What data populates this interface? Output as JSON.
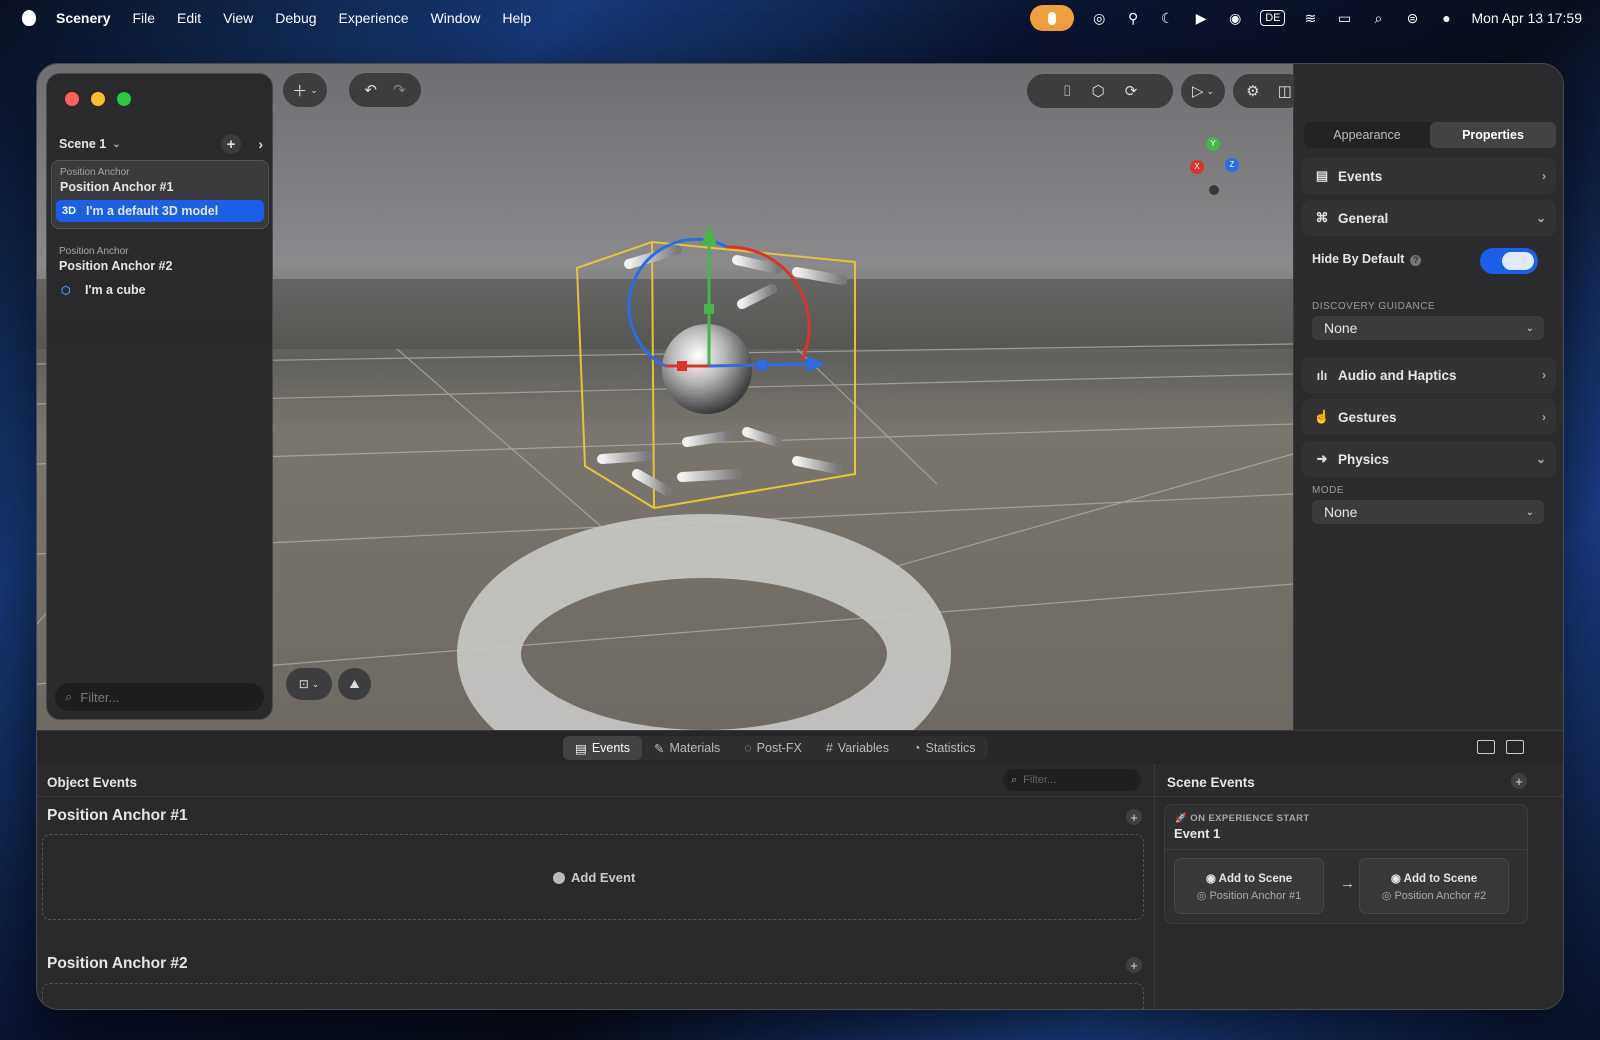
{
  "menubar": {
    "app_name": "Scenery",
    "items": [
      "File",
      "Edit",
      "View",
      "Debug",
      "Experience",
      "Window",
      "Help"
    ],
    "input_source": "DE",
    "clock": "Mon Apr 13  17:59"
  },
  "sidebar": {
    "scene_name": "Scene 1",
    "anchors": [
      {
        "kind": "Position Anchor",
        "name": "Position Anchor #1",
        "child_badge": "3D",
        "child_label": "I'm a default 3D model"
      },
      {
        "kind": "Position Anchor",
        "name": "Position Anchor #2",
        "child_badge": "",
        "child_label": "I'm a cube"
      }
    ],
    "filter_placeholder": "Filter..."
  },
  "gizmo": {
    "y": "Y",
    "x": "X",
    "z": "Z"
  },
  "inspector": {
    "tabs": [
      "Appearance",
      "Properties"
    ],
    "active_tab": "Properties",
    "sections": {
      "events": "Events",
      "general": "General",
      "audio": "Audio and Haptics",
      "gestures": "Gestures",
      "physics": "Physics"
    },
    "hide_by_default_label": "Hide By Default",
    "hide_by_default": true,
    "discovery_caption": "DISCOVERY GUIDANCE",
    "discovery_value": "None",
    "mode_caption": "MODE",
    "mode_value": "None"
  },
  "bottom_tabs": [
    "Events",
    "Materials",
    "Post-FX",
    "Variables",
    "Statistics"
  ],
  "active_bottom_tab": "Events",
  "object_events": {
    "title": "Object Events",
    "filter_placeholder": "Filter...",
    "groups": [
      {
        "name": "Position Anchor #1",
        "add_event": "Add Event"
      },
      {
        "name": "Position Anchor #2"
      }
    ]
  },
  "scene_events": {
    "title": "Scene Events",
    "event": {
      "trigger": "ON EXPERIENCE START",
      "name": "Event 1",
      "actions": [
        {
          "title": "Add to Scene",
          "target": "Position Anchor #1"
        },
        {
          "title": "Add to Scene",
          "target": "Position Anchor #2"
        }
      ]
    }
  },
  "colors": {
    "accent": "#1a5fe6",
    "mic": "#f0a03c",
    "close": "#ff5f57",
    "minimize": "#febc2e",
    "zoom": "#28c840",
    "bbox": "#e6c43a"
  }
}
